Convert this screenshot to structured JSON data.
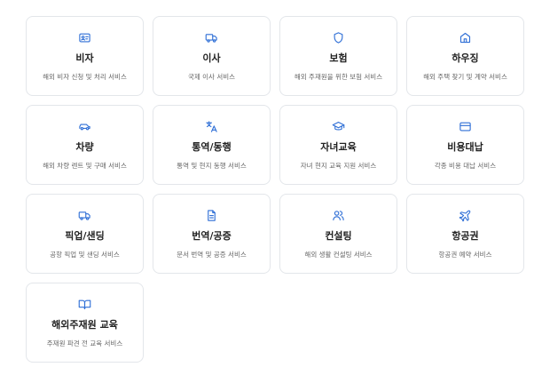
{
  "services": [
    {
      "icon": "id-card-icon",
      "title": "비자",
      "desc": "해외 비자 신청 및 처리 서비스"
    },
    {
      "icon": "truck-icon",
      "title": "이사",
      "desc": "국제 이사 서비스"
    },
    {
      "icon": "shield-icon",
      "title": "보험",
      "desc": "해외 주재원을 위한 보험 서비스"
    },
    {
      "icon": "home-icon",
      "title": "하우징",
      "desc": "해외 주택 찾기 및 계약 서비스"
    },
    {
      "icon": "car-icon",
      "title": "차량",
      "desc": "해외 차량 렌트 및 구매 서비스"
    },
    {
      "icon": "translate-icon",
      "title": "통역/동행",
      "desc": "통역 및 현지 동행 서비스"
    },
    {
      "icon": "graduation-cap-icon",
      "title": "자녀교육",
      "desc": "자녀 현지 교육 지원 서비스"
    },
    {
      "icon": "credit-card-icon",
      "title": "비용대납",
      "desc": "각종 비용 대납 서비스"
    },
    {
      "icon": "truck-icon",
      "title": "픽업/샌딩",
      "desc": "공항 픽업 및 샌딩 서비스"
    },
    {
      "icon": "document-icon",
      "title": "번역/공증",
      "desc": "문서 번역 및 공증 서비스"
    },
    {
      "icon": "users-icon",
      "title": "컨설팅",
      "desc": "해외 생활 컨설팅 서비스"
    },
    {
      "icon": "plane-icon",
      "title": "항공권",
      "desc": "항공권 예약 서비스"
    },
    {
      "icon": "book-icon",
      "title": "해외주재원 교육",
      "desc": "주재원 파견 전 교육 서비스"
    }
  ],
  "colors": {
    "accent": "#2f6fd6",
    "border": "#e3e6ea",
    "title": "#222222",
    "desc": "#666666"
  }
}
